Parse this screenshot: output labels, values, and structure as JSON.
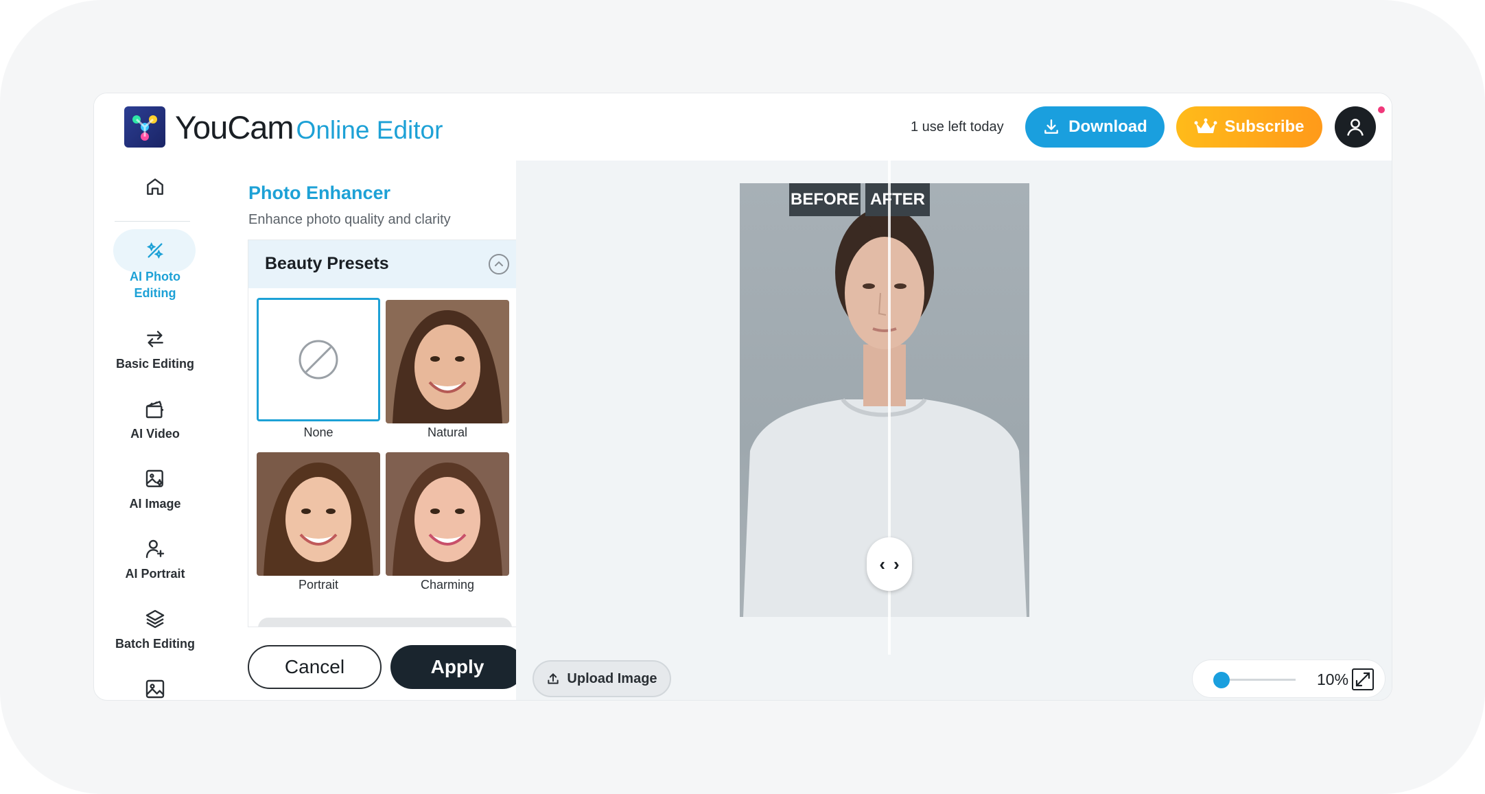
{
  "header": {
    "brand_name": "YouCam",
    "brand_suffix": "Online Editor",
    "uses_left": "1 use left today",
    "download_label": "Download",
    "subscribe_label": "Subscribe"
  },
  "sidebar": {
    "items": [
      {
        "label": "",
        "icon": "home-icon"
      },
      {
        "label": "AI Photo Editing",
        "icon": "magic-wand-icon",
        "active": true
      },
      {
        "label": "Basic Editing",
        "icon": "swap-arrows-icon"
      },
      {
        "label": "AI Video",
        "icon": "clapperboard-icon"
      },
      {
        "label": "AI Image",
        "icon": "image-sparkle-icon"
      },
      {
        "label": "AI Portrait",
        "icon": "person-add-icon"
      },
      {
        "label": "Batch Editing",
        "icon": "layers-icon"
      },
      {
        "label": "",
        "icon": "image-icon"
      }
    ]
  },
  "panel": {
    "title": "Photo Enhancer",
    "subtitle": "Enhance photo quality and clarity",
    "presets_header": "Beauty Presets",
    "presets": [
      {
        "label": "None",
        "selected": true
      },
      {
        "label": "Natural",
        "selected": false
      },
      {
        "label": "Portrait",
        "selected": false
      },
      {
        "label": "Charming",
        "selected": false
      }
    ],
    "cancel_label": "Cancel",
    "apply_label": "Apply"
  },
  "canvas": {
    "before_label": "BEFORE",
    "after_label": "AFTER",
    "upload_label": "Upload Image",
    "zoom_value": "10%",
    "zoom_level": 0.1
  },
  "colors": {
    "accent": "#1da1d6",
    "download_bg": "#1a9fde",
    "subscribe_bg": "#ff9a1a",
    "apply_bg": "#1a252e"
  }
}
